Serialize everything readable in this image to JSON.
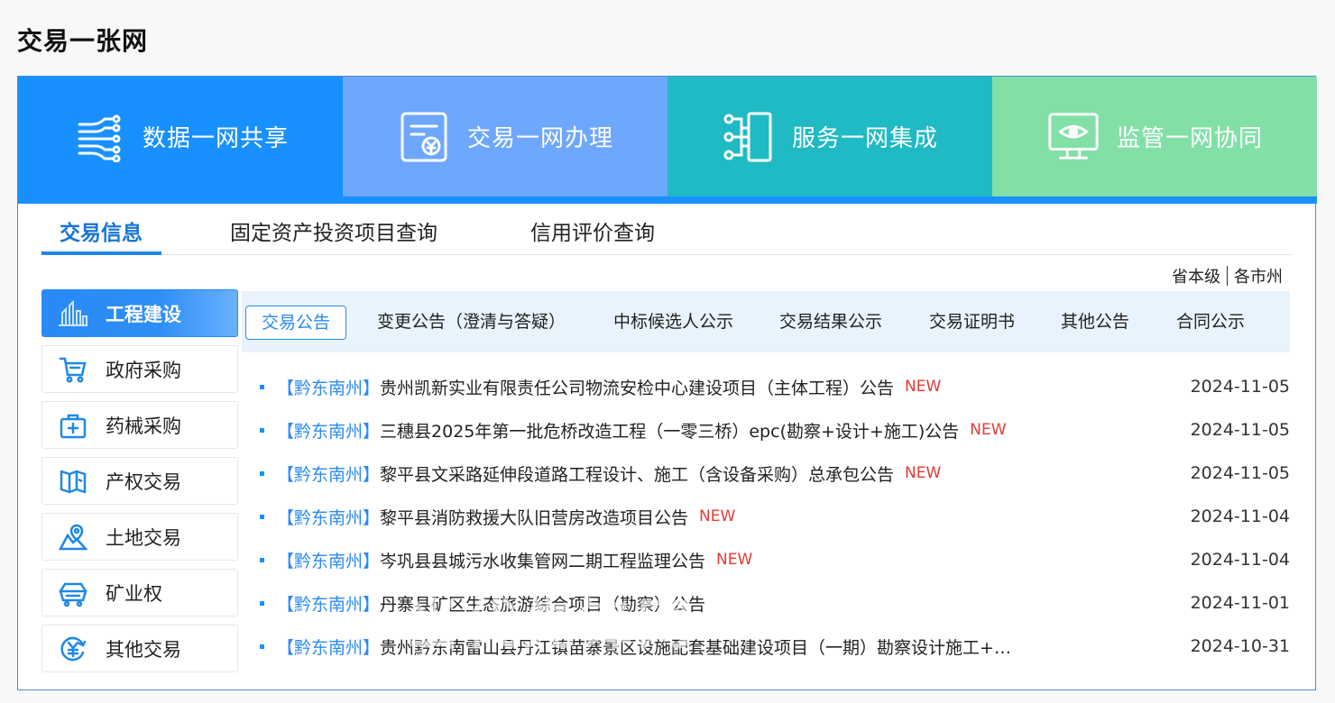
{
  "page_title": "交易一张网",
  "banner": [
    {
      "label": "数据一网共享",
      "color": "#1890ff",
      "icon": "data-share-icon"
    },
    {
      "label": "交易一网办理",
      "color": "#6ea7fe",
      "icon": "transaction-doc-icon"
    },
    {
      "label": "服务一网集成",
      "color": "#1fbac4",
      "icon": "service-integration-icon"
    },
    {
      "label": "监管一网协同",
      "color": "#82e0a7",
      "icon": "monitor-eye-icon"
    }
  ],
  "tabs": [
    "交易信息",
    "固定资产投资项目查询",
    "信用评价查询"
  ],
  "level_switch": [
    "省本级",
    "各市州"
  ],
  "side_menu": [
    {
      "label": "工程建设",
      "icon": "construction-icon"
    },
    {
      "label": "政府采购",
      "icon": "shopping-cart-icon"
    },
    {
      "label": "药械采购",
      "icon": "medical-kit-icon"
    },
    {
      "label": "产权交易",
      "icon": "property-book-icon"
    },
    {
      "label": "土地交易",
      "icon": "land-location-icon"
    },
    {
      "label": "矿业权",
      "icon": "mining-cart-icon"
    },
    {
      "label": "其他交易",
      "icon": "yuan-circle-icon"
    }
  ],
  "sub_tabs": [
    "交易公告",
    "变更公告（澄清与答疑）",
    "中标候选人公示",
    "交易结果公示",
    "交易证明书",
    "其他公告",
    "合同公示"
  ],
  "news": [
    {
      "region": "【黔东南州】",
      "title": "贵州凯新实业有限责任公司物流安检中心建设项目（主体工程）公告",
      "new": "NEW",
      "date": "2024-11-05"
    },
    {
      "region": "【黔东南州】",
      "title": "三穗县2025年第一批危桥改造工程（一零三桥）epc(勘察+设计+施工)公告",
      "new": "NEW",
      "date": "2024-11-05"
    },
    {
      "region": "【黔东南州】",
      "title": "黎平县文采路延伸段道路工程设计、施工（含设备采购）总承包公告",
      "new": "NEW",
      "date": "2024-11-05"
    },
    {
      "region": "【黔东南州】",
      "title": "黎平县消防救援大队旧营房改造项目公告",
      "new": "NEW",
      "date": "2024-11-04"
    },
    {
      "region": "【黔东南州】",
      "title": "岑巩县县城污水收集管网二期工程监理公告",
      "new": "NEW",
      "date": "2024-11-04"
    },
    {
      "region": "【黔东南州】",
      "title": "丹寨县矿区生态旅游综合项目（勘察）公告",
      "new": "",
      "date": "2024-11-01"
    },
    {
      "region": "【黔东南州】",
      "title": "贵州黔东南雷山县丹江镇苗寨景区设施配套基础建设项目（一期）勘察设计施工+车…",
      "new": "",
      "date": "2024-10-31"
    }
  ],
  "watermark": "当代先锋网"
}
